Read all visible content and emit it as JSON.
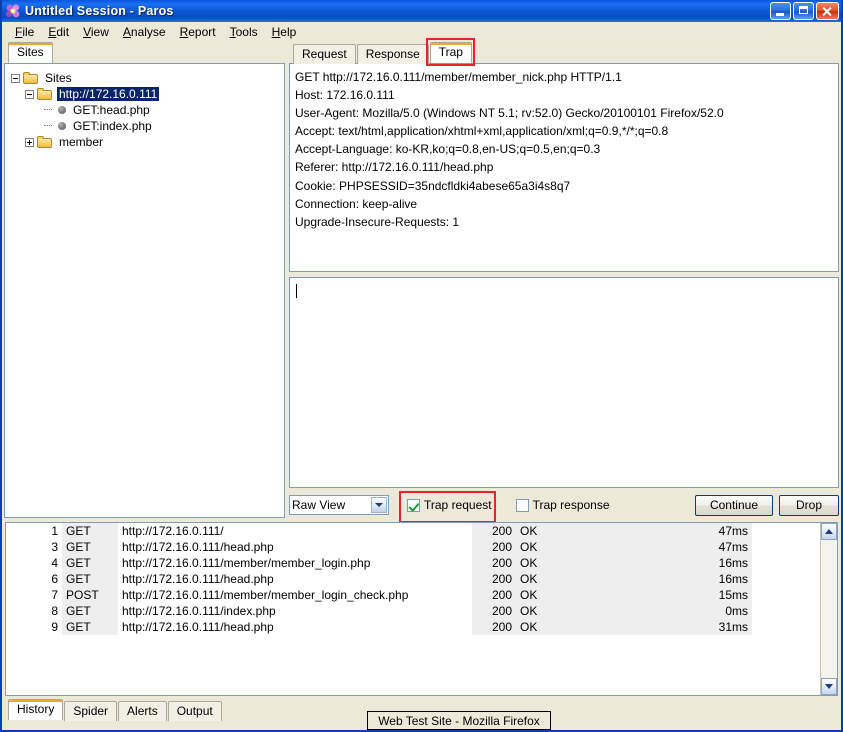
{
  "window": {
    "title": "Untitled Session - Paros",
    "icon": "paros-flower-icon",
    "minimize_label": "Minimize",
    "maximize_label": "Maximize",
    "close_label": "Close"
  },
  "menubar": {
    "items": [
      {
        "label": "File",
        "mnemonic": "F"
      },
      {
        "label": "Edit",
        "mnemonic": "E"
      },
      {
        "label": "View",
        "mnemonic": "V"
      },
      {
        "label": "Analyse",
        "mnemonic": "A"
      },
      {
        "label": "Report",
        "mnemonic": "R"
      },
      {
        "label": "Tools",
        "mnemonic": "T"
      },
      {
        "label": "Help",
        "mnemonic": "H"
      }
    ]
  },
  "left_panel": {
    "tab_label": "Sites",
    "tree": {
      "root": "Sites",
      "site": "http://172.16.0.111",
      "children": [
        {
          "label": "GET:head.php"
        },
        {
          "label": "GET:index.php"
        }
      ],
      "folder": "member"
    }
  },
  "right_panel": {
    "tabs": [
      {
        "label": "Request",
        "active": false
      },
      {
        "label": "Response",
        "active": false
      },
      {
        "label": "Trap",
        "active": true
      }
    ],
    "request_headers": [
      "GET http://172.16.0.111/member/member_nick.php HTTP/1.1",
      "Host: 172.16.0.111",
      "User-Agent: Mozilla/5.0 (Windows NT 5.1; rv:52.0) Gecko/20100101 Firefox/52.0",
      "Accept: text/html,application/xhtml+xml,application/xml;q=0.9,*/*;q=0.8",
      "Accept-Language: ko-KR,ko;q=0.8,en-US;q=0.5,en;q=0.3",
      "Referer: http://172.16.0.111/head.php",
      "Cookie: PHPSESSID=35ndcfldki4abese65a3i4s8q7",
      "Connection: keep-alive",
      "Upgrade-Insecure-Requests: 1"
    ],
    "editor_value": "",
    "controls": {
      "view_mode_selected": "Raw View",
      "view_mode_options": [
        "Raw View"
      ],
      "trap_request_label": "Trap request",
      "trap_request_checked": true,
      "trap_response_label": "Trap response",
      "trap_response_checked": false,
      "continue_label": "Continue",
      "drop_label": "Drop"
    }
  },
  "history": {
    "columns": [
      "id",
      "method",
      "url",
      "code",
      "reason",
      "time"
    ],
    "rows": [
      {
        "id": "1",
        "method": "GET",
        "url": "http://172.16.0.111/",
        "code": "200",
        "reason": "OK",
        "time": "47ms"
      },
      {
        "id": "3",
        "method": "GET",
        "url": "http://172.16.0.111/head.php",
        "code": "200",
        "reason": "OK",
        "time": "47ms"
      },
      {
        "id": "4",
        "method": "GET",
        "url": "http://172.16.0.111/member/member_login.php",
        "code": "200",
        "reason": "OK",
        "time": "16ms"
      },
      {
        "id": "6",
        "method": "GET",
        "url": "http://172.16.0.111/head.php",
        "code": "200",
        "reason": "OK",
        "time": "16ms"
      },
      {
        "id": "7",
        "method": "POST",
        "url": "http://172.16.0.111/member/member_login_check.php",
        "code": "200",
        "reason": "OK",
        "time": "15ms"
      },
      {
        "id": "8",
        "method": "GET",
        "url": "http://172.16.0.111/index.php",
        "code": "200",
        "reason": "OK",
        "time": "0ms"
      },
      {
        "id": "9",
        "method": "GET",
        "url": "http://172.16.0.111/head.php",
        "code": "200",
        "reason": "OK",
        "time": "31ms"
      }
    ]
  },
  "bottom_tabs": [
    {
      "label": "History",
      "active": true
    },
    {
      "label": "Spider",
      "active": false
    },
    {
      "label": "Alerts",
      "active": false
    },
    {
      "label": "Output",
      "active": false
    }
  ],
  "taskbar": {
    "item_label": "Web Test Site - Mozilla Firefox"
  },
  "colors": {
    "titlebar_blue": "#0d56d4",
    "annotation_red": "#e8232a",
    "selection_blue": "#0a246a",
    "active_tab_accent": "#f5a623",
    "face": "#ece9d8"
  }
}
